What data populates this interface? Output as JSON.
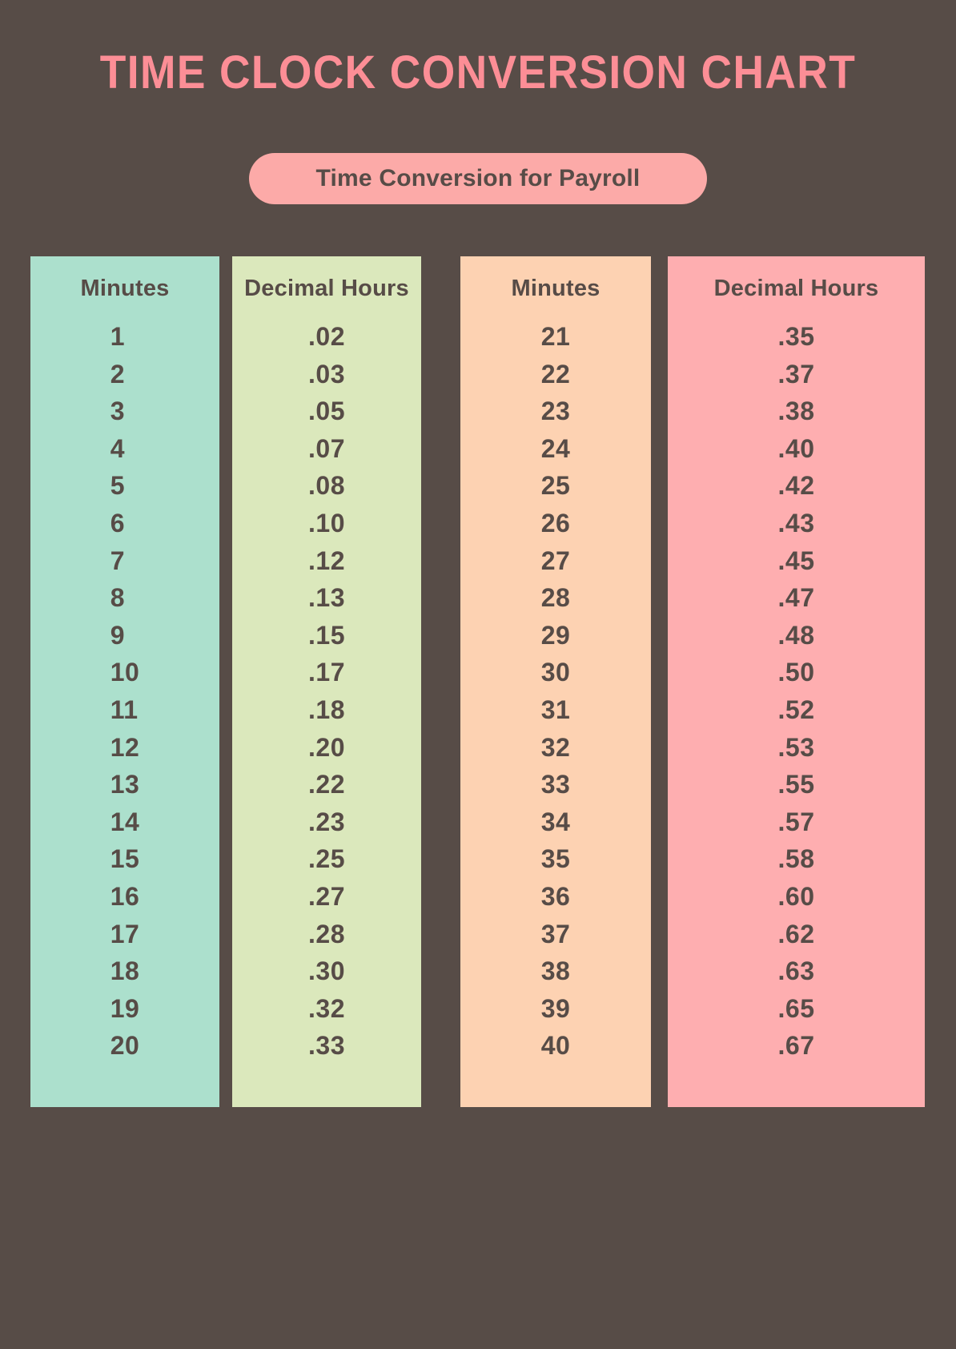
{
  "header": {
    "title": "TIME CLOCK CONVERSION CHART",
    "subtitle": "Time Conversion for Payroll"
  },
  "colors": {
    "background": "#574c47",
    "title_pink": "#fc8e96",
    "pill_pink": "#fcaaa8",
    "text_dark": "#574c47",
    "panel_mint": "#ace0cd",
    "panel_green": "#dbe8bc",
    "panel_peach": "#fdd2b2",
    "panel_pink": "#feaeb0"
  },
  "chart_data": {
    "type": "table",
    "title": "TIME CLOCK CONVERSION CHART",
    "subtitle": "Time Conversion for Payroll",
    "columns": [
      {
        "key": "minutes_1_20",
        "header": "Minutes",
        "color": "#ace0cd",
        "values": [
          "1",
          "2",
          "3",
          "4",
          "5",
          "6",
          "7",
          "8",
          "9",
          "10",
          "11",
          "12",
          "13",
          "14",
          "15",
          "16",
          "17",
          "18",
          "19",
          "20"
        ]
      },
      {
        "key": "decimal_1_20",
        "header": "Decimal Hours",
        "color": "#dbe8bc",
        "values": [
          ".02",
          ".03",
          ".05",
          ".07",
          ".08",
          ".10",
          ".12",
          ".13",
          ".15",
          ".17",
          ".18",
          ".20",
          ".22",
          ".23",
          ".25",
          ".27",
          ".28",
          ".30",
          ".32",
          ".33"
        ]
      },
      {
        "key": "minutes_21_40",
        "header": "Minutes",
        "color": "#fdd2b2",
        "values": [
          "21",
          "22",
          "23",
          "24",
          "25",
          "26",
          "27",
          "28",
          "29",
          "30",
          "31",
          "32",
          "33",
          "34",
          "35",
          "36",
          "37",
          "38",
          "39",
          "40"
        ]
      },
      {
        "key": "decimal_21_40",
        "header": "Decimal Hours",
        "color": "#feaeb0",
        "values": [
          ".35",
          ".37",
          ".38",
          ".40",
          ".42",
          ".43",
          ".45",
          ".47",
          ".48",
          ".50",
          ".52",
          ".53",
          ".55",
          ".57",
          ".58",
          ".60",
          ".62",
          ".63",
          ".65",
          ".67"
        ]
      }
    ]
  }
}
